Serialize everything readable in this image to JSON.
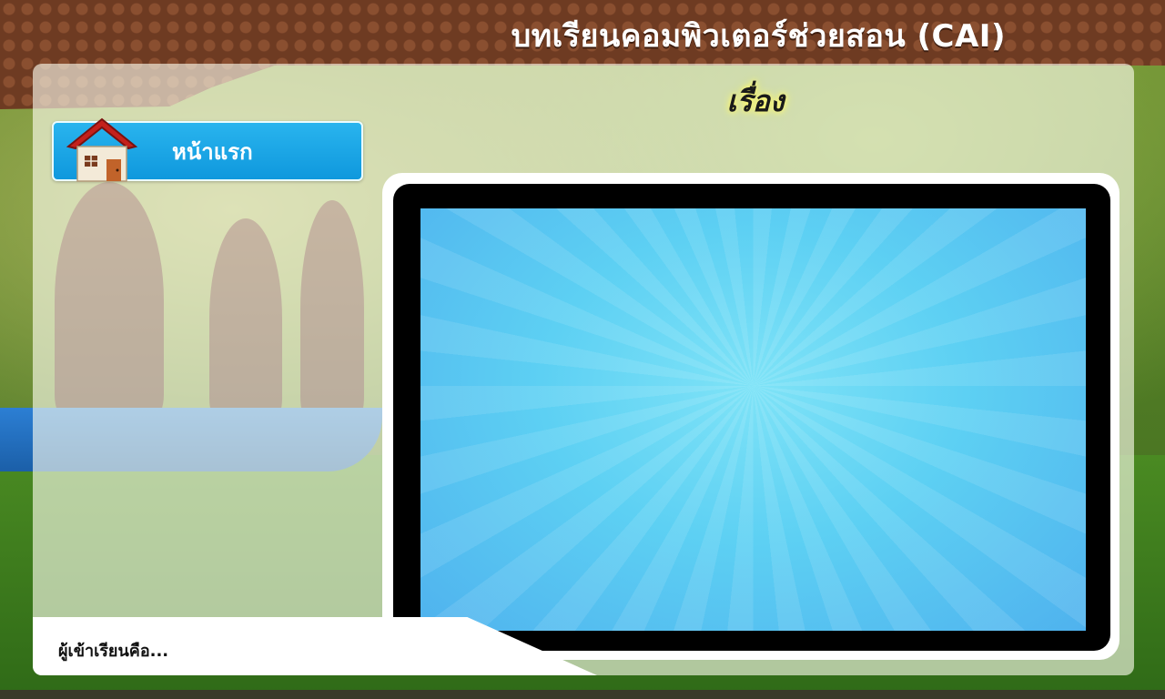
{
  "header": {
    "title": "บทเรียนคอมพิวเตอร์ช่วยสอน (CAI)"
  },
  "lesson": {
    "heading": "เรื่อง"
  },
  "nav": {
    "home_label": "หน้าแรก",
    "home_icon": "house-icon"
  },
  "learner": {
    "label": "ผู้เข้าเรียนคือ..."
  },
  "colors": {
    "header_brown": "#6e3b22",
    "home_button_blue": "#0f98dd",
    "screen_blue": "#5dd0f3"
  }
}
